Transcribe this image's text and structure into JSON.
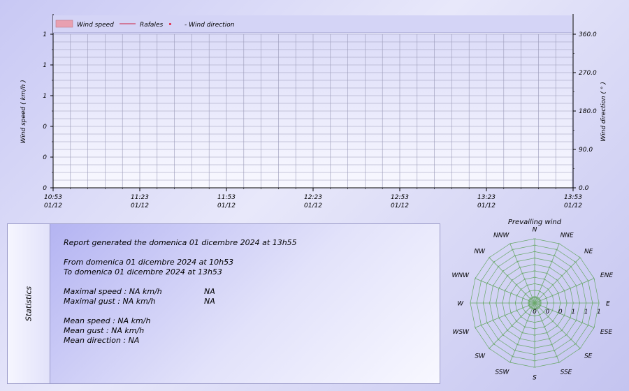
{
  "chart_data": [
    {
      "type": "line",
      "legend": [
        "Wind speed",
        "Rafales",
        "Wind direction"
      ],
      "legend_placement": "top",
      "ylabel": "Wind speed  ( km/h )",
      "y2label": "Wind direction  ( ° )",
      "y_tick_labels": [
        "0",
        "0",
        "0",
        "1",
        "1",
        "1"
      ],
      "y2_tick_labels": [
        "0.0",
        "90.0",
        "180.0",
        "270.0",
        "360.0"
      ],
      "ylim": [
        0,
        1
      ],
      "y2lim": [
        0,
        360
      ],
      "x_tick_labels": [
        {
          "time": "10:53",
          "date": "01/12"
        },
        {
          "time": "11:23",
          "date": "01/12"
        },
        {
          "time": "11:53",
          "date": "01/12"
        },
        {
          "time": "12:23",
          "date": "01/12"
        },
        {
          "time": "12:53",
          "date": "01/12"
        },
        {
          "time": "13:23",
          "date": "01/12"
        },
        {
          "time": "13:53",
          "date": "01/12"
        }
      ],
      "grid": true,
      "series": [
        {
          "name": "Wind speed",
          "values": []
        },
        {
          "name": "Rafales",
          "values": []
        },
        {
          "name": "Wind direction",
          "values": []
        }
      ],
      "colors": {
        "wind_speed": "#e8a0b0",
        "rafales": "#cc2040",
        "direction": "#e04060"
      }
    },
    {
      "type": "radar",
      "title": "Prevailing wind",
      "directions": [
        "N",
        "NNE",
        "NE",
        "ENE",
        "E",
        "ESE",
        "SE",
        "SSE",
        "S",
        "SSW",
        "SW",
        "WSW",
        "W",
        "WNW",
        "NW",
        "NNW"
      ],
      "radial_tick_labels": [
        "0",
        "0",
        "0",
        "1",
        "1",
        "1"
      ],
      "values": [
        0,
        0,
        0,
        0,
        0,
        0,
        0,
        0,
        0,
        0,
        0,
        0,
        0,
        0,
        0,
        0
      ],
      "color": "#6aa86a"
    }
  ],
  "statistics": {
    "title": "Statistics",
    "report_line": "Report generated the domenica 01 dicembre 2024 at 13h55",
    "from_line": "From domenica 01 dicembre 2024 at 10h53",
    "to_line": "To domenica 01 dicembre 2024 at 13h53",
    "max_speed": "Maximal speed : NA km/h",
    "max_speed_extra": "NA",
    "max_gust": "Maximal gust : NA km/h",
    "max_gust_extra": "NA",
    "mean_speed": "Mean speed : NA km/h",
    "mean_gust": "Mean gust : NA km/h",
    "mean_direction": "Mean direction : NA"
  }
}
